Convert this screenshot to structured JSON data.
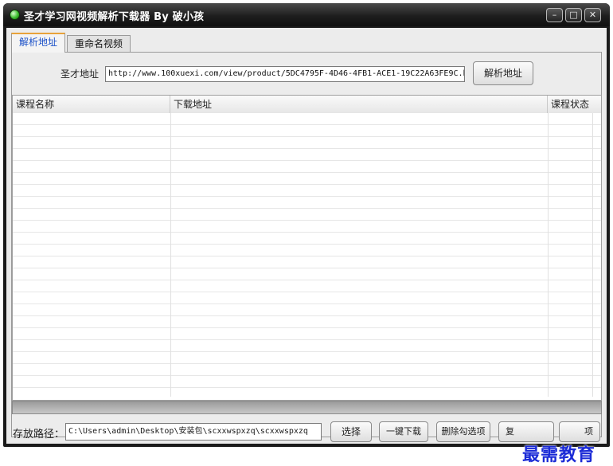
{
  "window": {
    "title": "圣才学习网视频解析下载器 By 破小孩",
    "controls": {
      "minimize": "–",
      "maximize": "□",
      "close": "✕"
    }
  },
  "tabs": [
    {
      "label": "解析地址",
      "active": true
    },
    {
      "label": "重命名视频",
      "active": false
    }
  ],
  "url_row": {
    "label": "圣才地址",
    "value": "http://www.100xuexi.com/view/product/5DC4795F-4D46-4FB1-ACE1-19C22A63FE9C.h",
    "parse_button": "解析地址"
  },
  "table": {
    "columns": [
      "课程名称",
      "下载地址",
      "课程状态"
    ],
    "rows": []
  },
  "bottom_bar": {
    "save_label": "存放路径：",
    "save_path": "C:\\Users\\admin\\Desktop\\安装包\\scxxwspxzq\\scxxwspxzq",
    "buttons": {
      "select": "选择",
      "download_all": "一键下载",
      "delete_checked": "删除勾选项",
      "reset_partial": "复",
      "reset_end": "项"
    }
  },
  "watermark": "最需教育",
  "colors": {
    "active_tab_text": "#1a50c8",
    "active_tab_accent": "#e8a33a",
    "watermark": "#1a2ad6"
  }
}
